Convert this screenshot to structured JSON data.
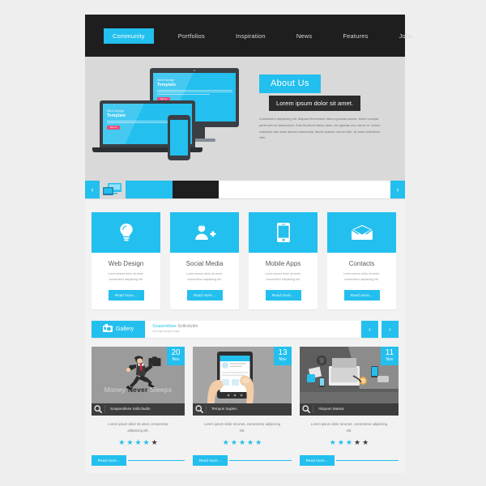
{
  "theme": {
    "accent": "#23bfee",
    "dark": "#1e1e1e",
    "pink": "#ec4a7b",
    "page_bg": "#f2f2f2",
    "hero_bg": "#d9d9d9"
  },
  "header": {
    "nav": [
      {
        "label": "Community",
        "active": true
      },
      {
        "label": "Portfolios",
        "active": false
      },
      {
        "label": "Inspiration",
        "active": false
      },
      {
        "label": "News",
        "active": false
      },
      {
        "label": "Features",
        "active": false
      },
      {
        "label": "Jobs",
        "active": false
      }
    ]
  },
  "hero": {
    "device_screen": {
      "small_title": "Web Design",
      "big_title": "Template",
      "button_label": "Sign up"
    },
    "about_tag": "About Us",
    "sub_tag": "Lorem ipsum dolor sit amet.",
    "body": "Consectetur adipiscing elit. Aliquam fermentum diam a gravida lacinia. Morbi volutpat porta sem at ullamcorper. Duis tincidunt metus diam, vel egestas orci rutrum in. Donec vulputate odio vitae laoreet malesuada. Morbi sodales rutrum nibh, sit amet sollicitudin nibh."
  },
  "slider": {
    "prev_icon": "chevron-left-icon",
    "next_icon": "chevron-right-icon",
    "screens_icon": "screens-icon",
    "thumbs": [
      "cyan",
      "dark",
      "white"
    ]
  },
  "services": [
    {
      "icon": "lightbulb-icon",
      "title": "Web Design",
      "text": "Lorem ipsum dolor sit amet, consectetur adipiscing elit.",
      "button": "Read more..."
    },
    {
      "icon": "user-add-icon",
      "title": "Social Media",
      "text": "Lorem ipsum dolor sit amet, consectetur adipiscing elit.",
      "button": "Read more..."
    },
    {
      "icon": "smartphone-icon",
      "title": "Mobile Apps",
      "text": "Lorem ipsum dolor sit amet, consectetur adipiscing elit.",
      "button": "Read more..."
    },
    {
      "icon": "envelope-icon",
      "title": "Contacts",
      "text": "Lorem ipsum dolor sit amet, consectetur adipiscing elit.",
      "button": "Read more..."
    }
  ],
  "gallery": {
    "label": "Gallery",
    "icon": "camera-icon",
    "title_accent": "Suspendisse",
    "title_rest": " Sollicitudin",
    "subtitle": "Duis eget semper turpis",
    "prev_icon": "chevron-left-icon",
    "next_icon": "chevron-right-icon"
  },
  "posts": [
    {
      "day": "20",
      "month": "Nov",
      "art": "money-never-sleeps",
      "art_text_1": "Money ",
      "art_text_bold": "Never",
      "art_text_2": " Sleeps",
      "caption": "Suspendisse Sollicitudin",
      "caption_icon": "search-icon",
      "text": "Lorem ipsum dolor sit amet, consectetur adipiscing elit.",
      "rating": 4,
      "rating_max": 5,
      "button": "Read more..."
    },
    {
      "day": "13",
      "month": "Nov",
      "art": "tablet-in-hands",
      "caption": "Tempus Sapien",
      "caption_icon": "search-icon",
      "text": "Lorem ipsum dolor sit amet, consectetur adipiscing elit.",
      "rating": 5,
      "rating_max": 5,
      "button": "Read more..."
    },
    {
      "day": "11",
      "month": "Nov",
      "art": "desk-workspace",
      "caption": "Aliquam Massa",
      "caption_icon": "search-icon",
      "text": "Lorem ipsum dolor sit amet, consectetur adipiscing elit.",
      "rating": 3,
      "rating_max": 5,
      "button": "Read more..."
    }
  ]
}
